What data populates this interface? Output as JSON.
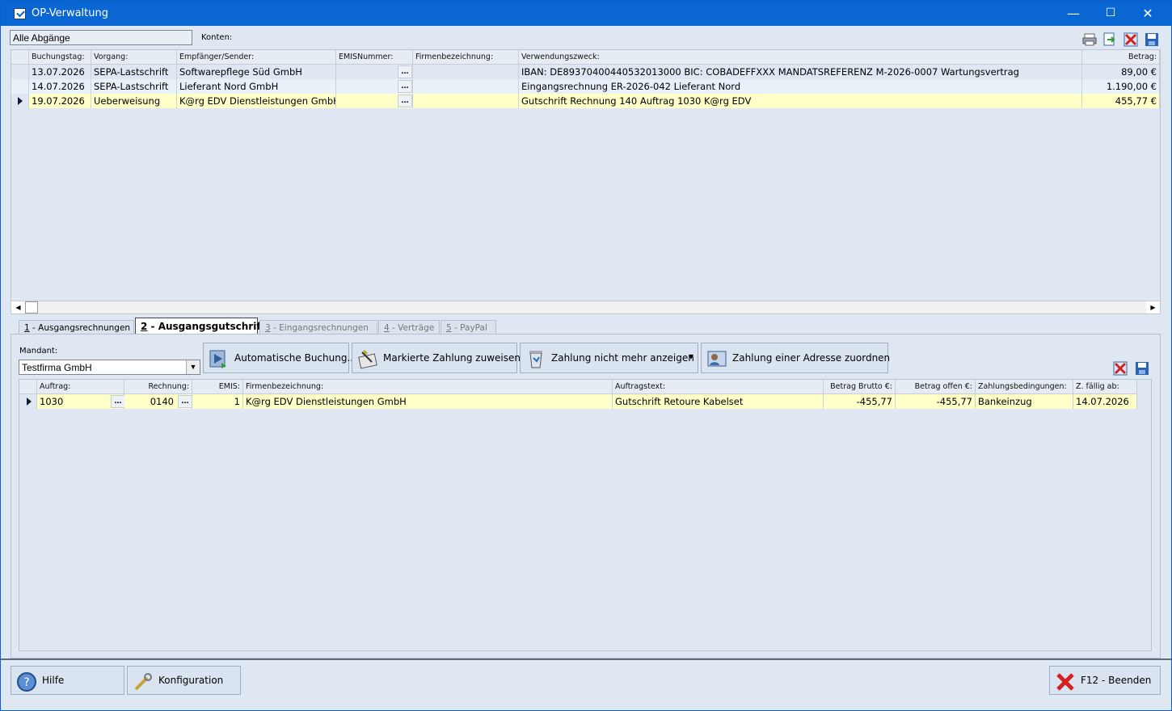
{
  "window": {
    "title": "OP-Verwaltung",
    "minimize": "—",
    "maximize": "☐",
    "close": "✕"
  },
  "filter": {
    "value": "Alle Abgänge"
  },
  "konten_label": "Konten:",
  "top_grid": {
    "headers": [
      "Buchungstag:",
      "Vorgang:",
      "Empfänger/Sender:",
      "EMISNummer:",
      "Firmenbezeichnung:",
      "Verwendungszweck:",
      "Betrag:"
    ],
    "rows": [
      {
        "date": "13.07.2026",
        "vorgang": "SEPA-Lastschrift",
        "empf": "Softwarepflege Süd GmbH",
        "emis": "",
        "firma": "",
        "zweck": "IBAN: DE89370400440532013000 BIC: COBADEFFXXX MANDATSREFERENZ M-2026-0007 Wartungsvertrag",
        "betrag": "89,00 €"
      },
      {
        "date": "14.07.2026",
        "vorgang": "SEPA-Lastschrift",
        "empf": "Lieferant Nord GmbH",
        "emis": "",
        "firma": "",
        "zweck": "Eingangsrechnung ER-2026-042 Lieferant Nord",
        "betrag": "1.190,00 €"
      },
      {
        "date": "19.07.2026",
        "vorgang": "Ueberweisung",
        "empf": "K@rg EDV Dienstleistungen GmbH",
        "emis": "",
        "firma": "",
        "zweck": "Gutschrift Rechnung 140 Auftrag 1030 K@rg EDV",
        "betrag": "455,77 €"
      }
    ],
    "dots": "..."
  },
  "tabs": [
    {
      "num": "1",
      "label": " - Ausgangsrechnungen"
    },
    {
      "num": "2",
      "label": " - Ausgangsgutschriften"
    },
    {
      "num": "3",
      "label": " - Eingangsrechnungen"
    },
    {
      "num": "4",
      "label": " - Verträge"
    },
    {
      "num": "5",
      "label": " - PayPal"
    }
  ],
  "mandant": {
    "label": "Mandant:",
    "value": "Testfirma GmbH"
  },
  "buttons": {
    "auto": "Automatische Buchung...",
    "mark": "Markierte Zahlung zuweisen...",
    "hide": "Zahlung nicht mehr anzeigen",
    "addr": "Zahlung einer Adresse zuordnen"
  },
  "bottom_grid": {
    "headers": [
      "Auftrag:",
      "Rechnung:",
      "EMIS:",
      "Firmenbezeichnung:",
      "Auftragstext:",
      "Betrag Brutto €:",
      "Betrag offen €:",
      "Zahlungsbedingungen:",
      "Z. fällig ab:"
    ],
    "row": {
      "auftrag": "1030",
      "rechnung": "0140",
      "emis": "1",
      "firma": "K@rg EDV Dienstleistungen GmbH",
      "text": "Gutschrift Retoure Kabelset",
      "brutto": "-455,77",
      "offen": "-455,77",
      "zb": "Bankeinzug",
      "faellig": "14.07.2026"
    }
  },
  "footer": {
    "hilfe": "Hilfe",
    "konfig": "Konfiguration",
    "beenden": "F12 - Beenden"
  },
  "colors": {
    "titlebar": "#0a66d2",
    "selected_row": "#ffffc8",
    "window_bg": "#dfe8f2"
  }
}
